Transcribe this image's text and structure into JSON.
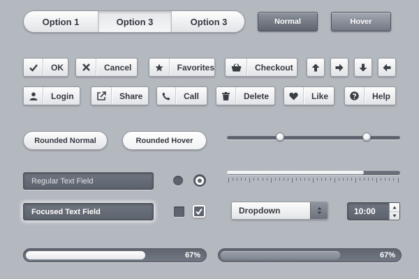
{
  "segmented": {
    "options": [
      "Option 1",
      "Option 3",
      "Option 3"
    ],
    "selected_index": 1
  },
  "dark_buttons": {
    "normal": "Normal",
    "hover": "Hover"
  },
  "icon_buttons_row1": {
    "ok": "OK",
    "cancel": "Cancel",
    "favorites": "Favorites",
    "checkout": "Checkout"
  },
  "arrow_buttons": [
    "arrow-up-icon",
    "arrow-right-icon",
    "arrow-down-icon",
    "arrow-left-icon"
  ],
  "icon_buttons_row2": {
    "login": "Login",
    "share": "Share",
    "call": "Call",
    "delete": "Delete",
    "like": "Like",
    "help": "Help"
  },
  "rounded_buttons": {
    "normal": "Rounded Normal",
    "hover": "Rounded Hover"
  },
  "range_slider": {
    "low": 0.31,
    "high": 0.81
  },
  "scale_slider": {
    "value": 0.79
  },
  "text_fields": {
    "regular": "Regular Text Field",
    "focused": "Focused Text Field"
  },
  "radios": {
    "selected_index": 1
  },
  "checkboxes": {
    "checked_index": 1
  },
  "dropdown": {
    "value": "Dropdown"
  },
  "time_stepper": {
    "value": "10:00"
  },
  "progress_light": {
    "value": 0.67,
    "label": "67%"
  },
  "progress_dark": {
    "value": 0.67,
    "label": "67%"
  },
  "colors": {
    "background": "#b4b8bf",
    "dark_control": "#5f656f",
    "light_control": "#f2f3f4"
  }
}
